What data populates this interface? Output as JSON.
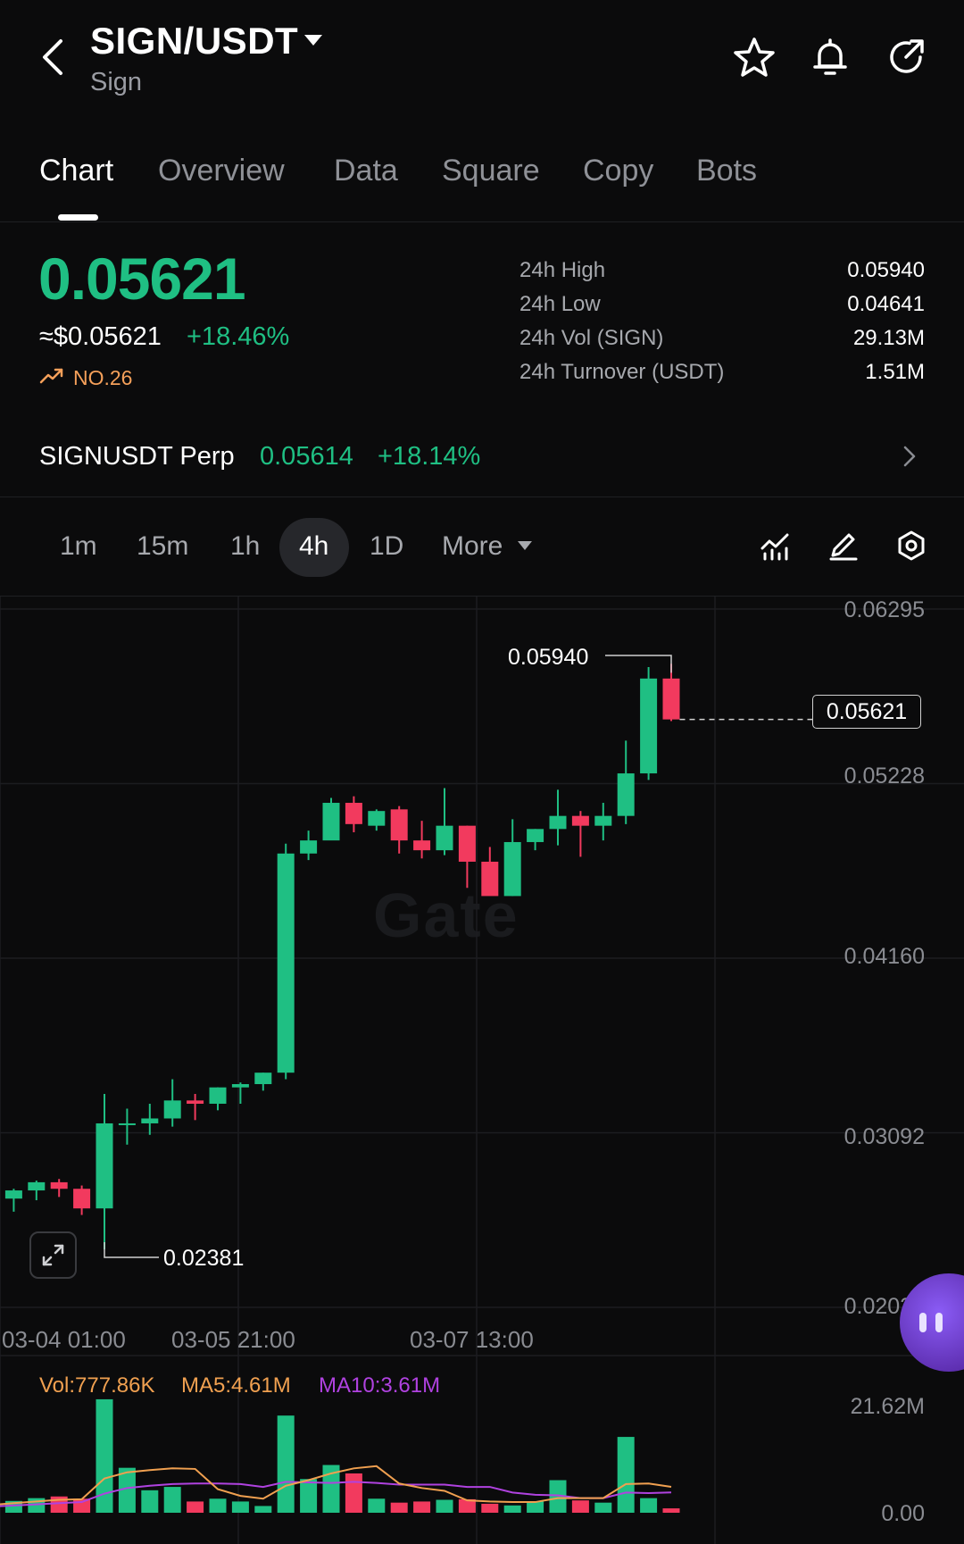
{
  "header": {
    "pair": "SIGN/USDT",
    "name": "Sign"
  },
  "tabs": [
    {
      "label": "Chart"
    },
    {
      "label": "Overview"
    },
    {
      "label": "Data"
    },
    {
      "label": "Square"
    },
    {
      "label": "Copy"
    },
    {
      "label": "Bots"
    }
  ],
  "ticker": {
    "last_price": "0.05621",
    "usd_price": "≈$0.05621",
    "change": "+18.46%",
    "rank": "NO.26",
    "stats": [
      {
        "label": "24h  High",
        "value": "0.05940"
      },
      {
        "label": "24h  Low",
        "value": "0.04641"
      },
      {
        "label": "24h  Vol (SIGN)",
        "value": "29.13M"
      },
      {
        "label": "24h  Turnover (USDT)",
        "value": "1.51M"
      }
    ]
  },
  "perp": {
    "name": "SIGNUSDT Perp",
    "price": "0.05614",
    "change": "+18.14%"
  },
  "timeframes": [
    {
      "label": "1m"
    },
    {
      "label": "15m"
    },
    {
      "label": "1h"
    },
    {
      "label": "4h",
      "active": true
    },
    {
      "label": "1D"
    },
    {
      "label": "More"
    }
  ],
  "colors": {
    "up": "#1fbf83",
    "down": "#f23a5e",
    "ma5": "#f0a050",
    "ma10": "#b042e0",
    "bg": "#0b0b0c"
  },
  "watermark": "Gate",
  "chart_data": {
    "type": "candlestick",
    "y_axis_labels": [
      "0.06295",
      "0.05228",
      "0.04160",
      "0.03092",
      "0.02025"
    ],
    "ylim": [
      0.02025,
      0.06295
    ],
    "x_axis_labels": [
      "03-04 01:00",
      "03-05 21:00",
      "03-07 13:00"
    ],
    "max_label": "0.05940",
    "min_label": "0.02381",
    "current_price_label": "0.05621",
    "candles": [
      {
        "o": 0.0267,
        "h": 0.0272,
        "l": 0.0264,
        "c": 0.0269
      },
      {
        "o": 0.0269,
        "h": 0.0275,
        "l": 0.0261,
        "c": 0.0274
      },
      {
        "o": 0.0274,
        "h": 0.028,
        "l": 0.0268,
        "c": 0.0279
      },
      {
        "o": 0.0279,
        "h": 0.0281,
        "l": 0.027,
        "c": 0.0275
      },
      {
        "o": 0.0275,
        "h": 0.0277,
        "l": 0.0259,
        "c": 0.0263
      },
      {
        "o": 0.0263,
        "h": 0.0333,
        "l": 0.0238,
        "c": 0.0315
      },
      {
        "o": 0.0315,
        "h": 0.0324,
        "l": 0.0302,
        "c": 0.0315
      },
      {
        "o": 0.0315,
        "h": 0.0327,
        "l": 0.0308,
        "c": 0.0318
      },
      {
        "o": 0.0318,
        "h": 0.0342,
        "l": 0.0313,
        "c": 0.0329
      },
      {
        "o": 0.0329,
        "h": 0.0333,
        "l": 0.0317,
        "c": 0.0327
      },
      {
        "o": 0.0327,
        "h": 0.0337,
        "l": 0.0323,
        "c": 0.0337
      },
      {
        "o": 0.0337,
        "h": 0.034,
        "l": 0.0327,
        "c": 0.0339
      },
      {
        "o": 0.0339,
        "h": 0.0346,
        "l": 0.0335,
        "c": 0.0346
      },
      {
        "o": 0.0346,
        "h": 0.0486,
        "l": 0.0342,
        "c": 0.048
      },
      {
        "o": 0.048,
        "h": 0.0494,
        "l": 0.0476,
        "c": 0.0488
      },
      {
        "o": 0.0488,
        "h": 0.0514,
        "l": 0.0489,
        "c": 0.0511
      },
      {
        "o": 0.0511,
        "h": 0.0515,
        "l": 0.0493,
        "c": 0.0498
      },
      {
        "o": 0.0497,
        "h": 0.0507,
        "l": 0.0494,
        "c": 0.0506
      },
      {
        "o": 0.0507,
        "h": 0.0509,
        "l": 0.048,
        "c": 0.0488
      },
      {
        "o": 0.0488,
        "h": 0.05,
        "l": 0.0477,
        "c": 0.0482
      },
      {
        "o": 0.0482,
        "h": 0.052,
        "l": 0.0479,
        "c": 0.0497
      },
      {
        "o": 0.0497,
        "h": 0.0497,
        "l": 0.0459,
        "c": 0.0475
      },
      {
        "o": 0.0475,
        "h": 0.0484,
        "l": 0.0456,
        "c": 0.0454
      },
      {
        "o": 0.0454,
        "h": 0.0501,
        "l": 0.0454,
        "c": 0.0487
      },
      {
        "o": 0.0487,
        "h": 0.0495,
        "l": 0.0482,
        "c": 0.0495
      },
      {
        "o": 0.0495,
        "h": 0.0519,
        "l": 0.0485,
        "c": 0.0503
      },
      {
        "o": 0.0503,
        "h": 0.0506,
        "l": 0.0478,
        "c": 0.0497
      },
      {
        "o": 0.0497,
        "h": 0.0511,
        "l": 0.0488,
        "c": 0.0503
      },
      {
        "o": 0.0503,
        "h": 0.0549,
        "l": 0.0498,
        "c": 0.0529
      },
      {
        "o": 0.0529,
        "h": 0.0594,
        "l": 0.0525,
        "c": 0.0587
      },
      {
        "o": 0.0587,
        "h": 0.0596,
        "l": 0.0561,
        "c": 0.0562
      }
    ],
    "volume": {
      "label": "Vol:777.86K",
      "ma5_label": "MA5:4.61M",
      "ma10_label": "MA10:3.61M",
      "max_label": "21.62M",
      "min_label": "0.00",
      "ylim": [
        0,
        21.62
      ],
      "values": [
        1.8,
        2.1,
        2.6,
        2.9,
        2.5,
        20.2,
        8.0,
        4.0,
        4.6,
        2.0,
        2.5,
        2.0,
        1.2,
        17.3,
        6.0,
        8.5,
        7.0,
        2.5,
        1.8,
        2.0,
        2.3,
        2.4,
        1.6,
        1.3,
        2.0,
        5.8,
        2.2,
        1.8,
        13.5,
        2.6,
        0.78
      ],
      "ma5": [
        1.4,
        1.7,
        2.0,
        2.3,
        2.4,
        6.1,
        7.2,
        7.6,
        7.9,
        7.8,
        4.2,
        3.0,
        2.5,
        4.8,
        5.8,
        7.0,
        7.9,
        8.3,
        5.2,
        4.4,
        3.9,
        2.2,
        2.0,
        1.9,
        1.9,
        2.6,
        2.6,
        2.6,
        5.1,
        5.2,
        4.61
      ],
      "ma10": [
        1.1,
        1.3,
        1.5,
        1.7,
        1.9,
        3.4,
        4.4,
        4.8,
        5.1,
        5.2,
        5.2,
        5.1,
        4.6,
        5.5,
        5.4,
        5.3,
        5.5,
        5.3,
        5.0,
        5.0,
        5.0,
        4.6,
        4.6,
        3.6,
        3.2,
        3.1,
        2.6,
        2.6,
        3.6,
        3.5,
        3.61
      ]
    }
  }
}
